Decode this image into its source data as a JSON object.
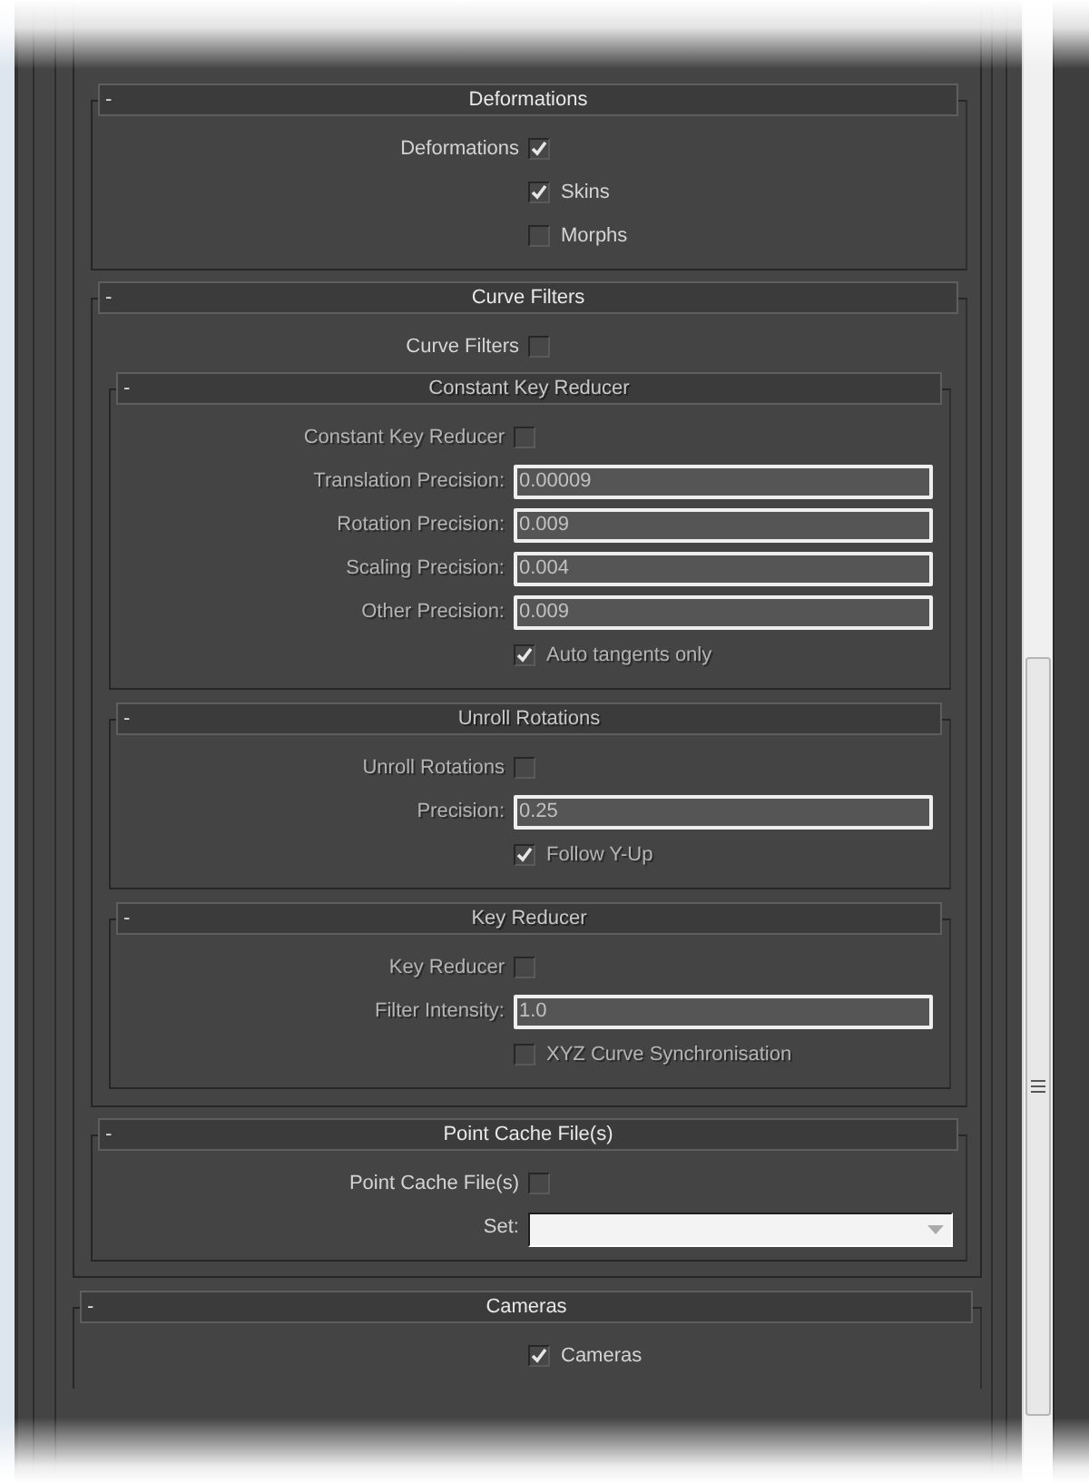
{
  "panel": {
    "rollouts": [
      {
        "title": "Deformations",
        "collapse": "-",
        "disabled": false,
        "rows": [
          {
            "kind": "toggle",
            "label": "Deformations",
            "checked": true,
            "disabled": false
          },
          {
            "kind": "option",
            "label": "Skins",
            "checked": true,
            "disabled": false
          },
          {
            "kind": "option",
            "label": "Morphs",
            "checked": false,
            "disabled": false
          }
        ]
      },
      {
        "title": "Curve Filters",
        "collapse": "-",
        "disabled": false,
        "rows": [
          {
            "kind": "toggle",
            "label": "Curve Filters",
            "checked": false,
            "disabled": false
          },
          {
            "kind": "rollout",
            "title": "Constant Key Reducer",
            "collapse": "-",
            "disabled": true,
            "rows": [
              {
                "kind": "toggle",
                "label": "Constant Key Reducer",
                "checked": false,
                "disabled": true
              },
              {
                "kind": "field",
                "label": "Translation Precision:",
                "value": "0.00009",
                "disabled": true
              },
              {
                "kind": "field",
                "label": "Rotation Precision:",
                "value": "0.009",
                "disabled": true
              },
              {
                "kind": "field",
                "label": "Scaling Precision:",
                "value": "0.004",
                "disabled": true
              },
              {
                "kind": "field",
                "label": "Other Precision:",
                "value": "0.009",
                "disabled": true
              },
              {
                "kind": "option",
                "label": "Auto tangents only",
                "checked": true,
                "disabled": true
              }
            ]
          },
          {
            "kind": "rollout",
            "title": "Unroll Rotations",
            "collapse": "-",
            "disabled": true,
            "rows": [
              {
                "kind": "toggle",
                "label": "Unroll Rotations",
                "checked": false,
                "disabled": true
              },
              {
                "kind": "field",
                "label": "Precision:",
                "value": "0.25",
                "disabled": true
              },
              {
                "kind": "option",
                "label": "Follow Y-Up",
                "checked": true,
                "disabled": true
              }
            ]
          },
          {
            "kind": "rollout",
            "title": "Key Reducer",
            "collapse": "-",
            "disabled": true,
            "rows": [
              {
                "kind": "toggle",
                "label": "Key Reducer",
                "checked": false,
                "disabled": true
              },
              {
                "kind": "field",
                "label": "Filter Intensity:",
                "value": "1.0",
                "disabled": true
              },
              {
                "kind": "option",
                "label": "XYZ Curve Synchronisation",
                "checked": false,
                "disabled": true
              }
            ]
          }
        ]
      },
      {
        "title": "Point Cache File(s)",
        "collapse": "-",
        "disabled": false,
        "rows": [
          {
            "kind": "toggle",
            "label": "Point Cache File(s)",
            "checked": false,
            "disabled": false
          },
          {
            "kind": "dropdown",
            "label": "Set:",
            "disabled": false
          }
        ]
      }
    ]
  },
  "rollouts": [
    {
      "title": "Cameras",
      "collapse": "-",
      "disabled": false,
      "open_bottom": true,
      "rows": [
        {
          "kind": "option",
          "label": "Cameras",
          "checked": true,
          "disabled": false
        }
      ]
    }
  ]
}
